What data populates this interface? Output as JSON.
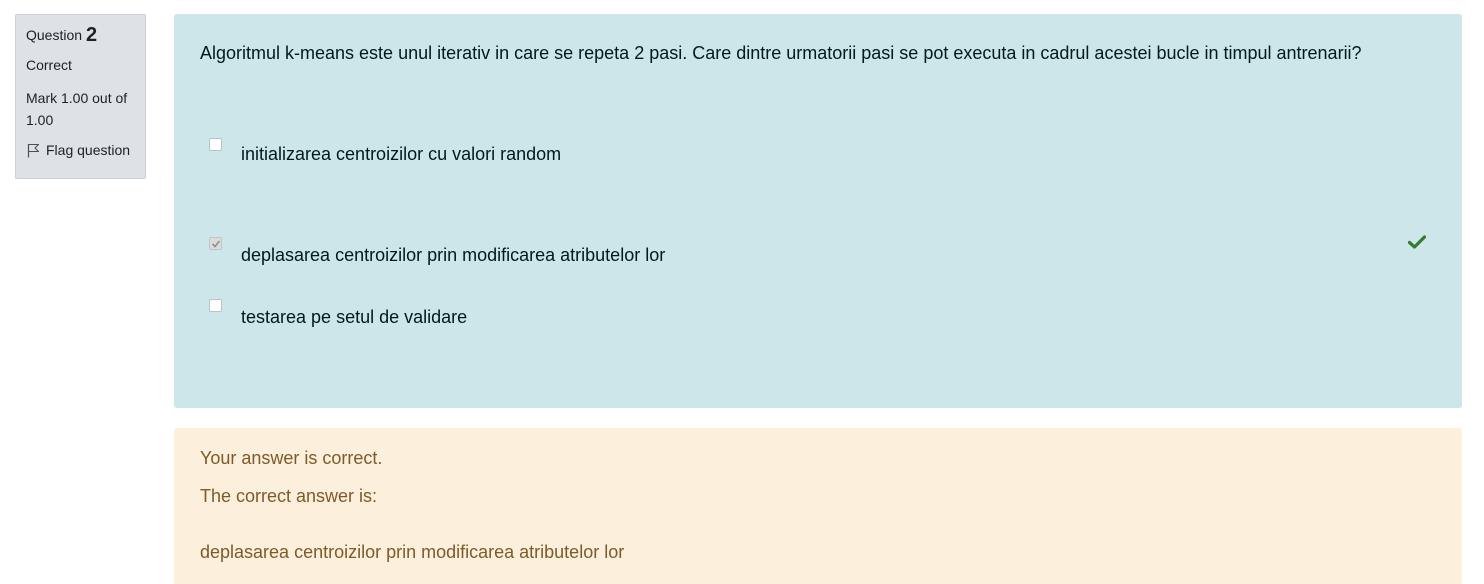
{
  "info": {
    "question_label": "Question",
    "question_number": "2",
    "state": "Correct",
    "grade_line1": "Mark 1.00 out of",
    "grade_line2": "1.00",
    "flag_label": "Flag question",
    "flag_icon": "flag-icon"
  },
  "formulation": {
    "question_text": "Algoritmul k-means este unul iterativ in care se repeta 2 pasi. Care dintre urmatorii pasi se pot executa in cadrul acestei bucle in timpul antrenarii?",
    "options": [
      {
        "label": "initializarea centroizilor cu valori random",
        "checked": false
      },
      {
        "label": "deplasarea centroizilor prin modificarea atributelor lor",
        "checked": true,
        "correct": true
      },
      {
        "label": "testarea pe setul de validare",
        "checked": false
      }
    ],
    "correct_icon": "checkmark-icon"
  },
  "feedback": {
    "status": "Your answer is correct.",
    "correct_answer_label": "The correct answer is:",
    "correct_answer": "deplasarea centroizilor prin modificarea atributelor lor"
  },
  "colors": {
    "info_background": "#dee2e6",
    "formulation_background": "#cce6ea",
    "feedback_background": "#fcefdc",
    "feedback_text": "#7d5a29",
    "correct_green": "#357a32"
  }
}
